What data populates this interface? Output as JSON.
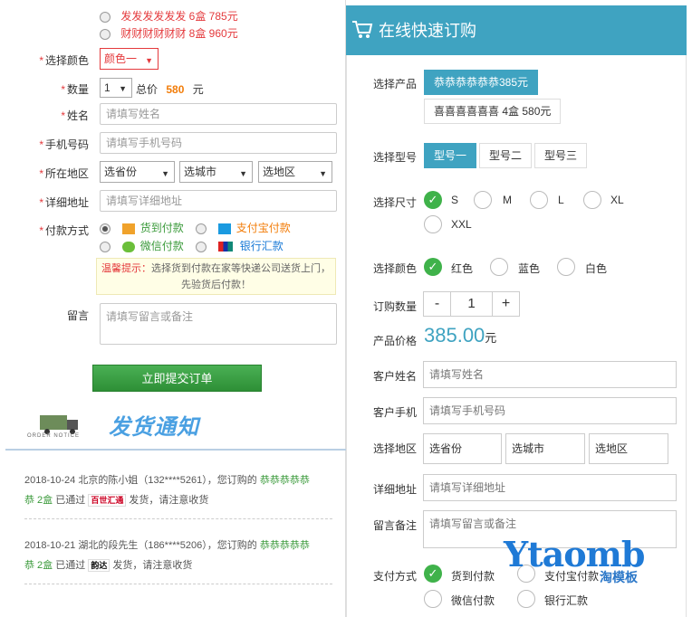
{
  "left": {
    "packages": [
      {
        "label": "发发发发发发 6盒 785元",
        "selected": false
      },
      {
        "label": "财财财财财财 8盒 960元",
        "selected": false
      }
    ],
    "color_label": "选择颜色",
    "color_value": "颜色一",
    "qty_label": "数量",
    "qty_value": "1",
    "total_label": "总价",
    "total_value": "580",
    "total_unit": "元",
    "name_label": "姓名",
    "name_placeholder": "请填写姓名",
    "phone_label": "手机号码",
    "phone_placeholder": "请填写手机号码",
    "region_label": "所在地区",
    "province": "选省份",
    "city": "选城市",
    "district": "选地区",
    "address_label": "详细地址",
    "address_placeholder": "请填写详细地址",
    "pay_label": "付款方式",
    "pay_options": [
      "货到付款",
      "支付宝付款",
      "微信付款",
      "银行汇款"
    ],
    "tip_prefix": "温馨提示：",
    "tip_text1": "选择货到付款在家等快递公司送货上门，",
    "tip_text2": "先验货后付款！",
    "message_label": "留言",
    "message_placeholder": "请填写留言或备注",
    "submit_label": "立即提交订单",
    "notice_title": "发货通知",
    "notice_en": "ORDER NOTICE",
    "orders": [
      {
        "line1": "2018-10-24 北京的陈小姐（132****5261），您订购的",
        "product": "恭恭恭恭恭",
        "product2": "恭 2盒",
        "passed": "已通过",
        "courier": "百世汇通",
        "tail": "发货，请注意收货"
      },
      {
        "line1": "2018-10-21 湖北的段先生（186****5206），您订购的",
        "product": "恭恭恭恭恭",
        "product2": "恭 2盒",
        "passed": "已通过",
        "courier": "韵达",
        "tail": "发货，请注意收货"
      }
    ]
  },
  "right": {
    "title": "在线快速订购",
    "product_label": "选择产品",
    "products": [
      "恭恭恭恭恭恭385元",
      "喜喜喜喜喜喜 4盒 580元"
    ],
    "model_label": "选择型号",
    "models": [
      "型号一",
      "型号二",
      "型号三"
    ],
    "size_label": "选择尺寸",
    "sizes": [
      "S",
      "M",
      "L",
      "XL",
      "XXL"
    ],
    "color_label": "选择颜色",
    "colors": [
      "红色",
      "蓝色",
      "白色"
    ],
    "qty_label": "订购数量",
    "qty_minus": "-",
    "qty_value": "1",
    "qty_plus": "+",
    "price_label": "产品价格",
    "price_value": "385.00",
    "price_unit": "元",
    "name_label": "客户姓名",
    "name_placeholder": "请填写姓名",
    "phone_label": "客户手机",
    "phone_placeholder": "请填写手机号码",
    "region_label": "选择地区",
    "province": "选省份",
    "city": "选城市",
    "district": "选地区",
    "address_label": "详细地址",
    "address_placeholder": "请填写详细地址",
    "message_label": "留言备注",
    "message_placeholder": "请填写留言或备注",
    "pay_label": "支付方式",
    "pay_options": [
      "货到付款",
      "支付宝付款",
      "微信付款",
      "银行汇款"
    ]
  },
  "watermark": {
    "brand": "Ytaomb",
    "sub": "淘模板"
  },
  "colors": {
    "accent": "#3fa3c1",
    "green": "#3fb24a",
    "red": "#e4393c"
  }
}
